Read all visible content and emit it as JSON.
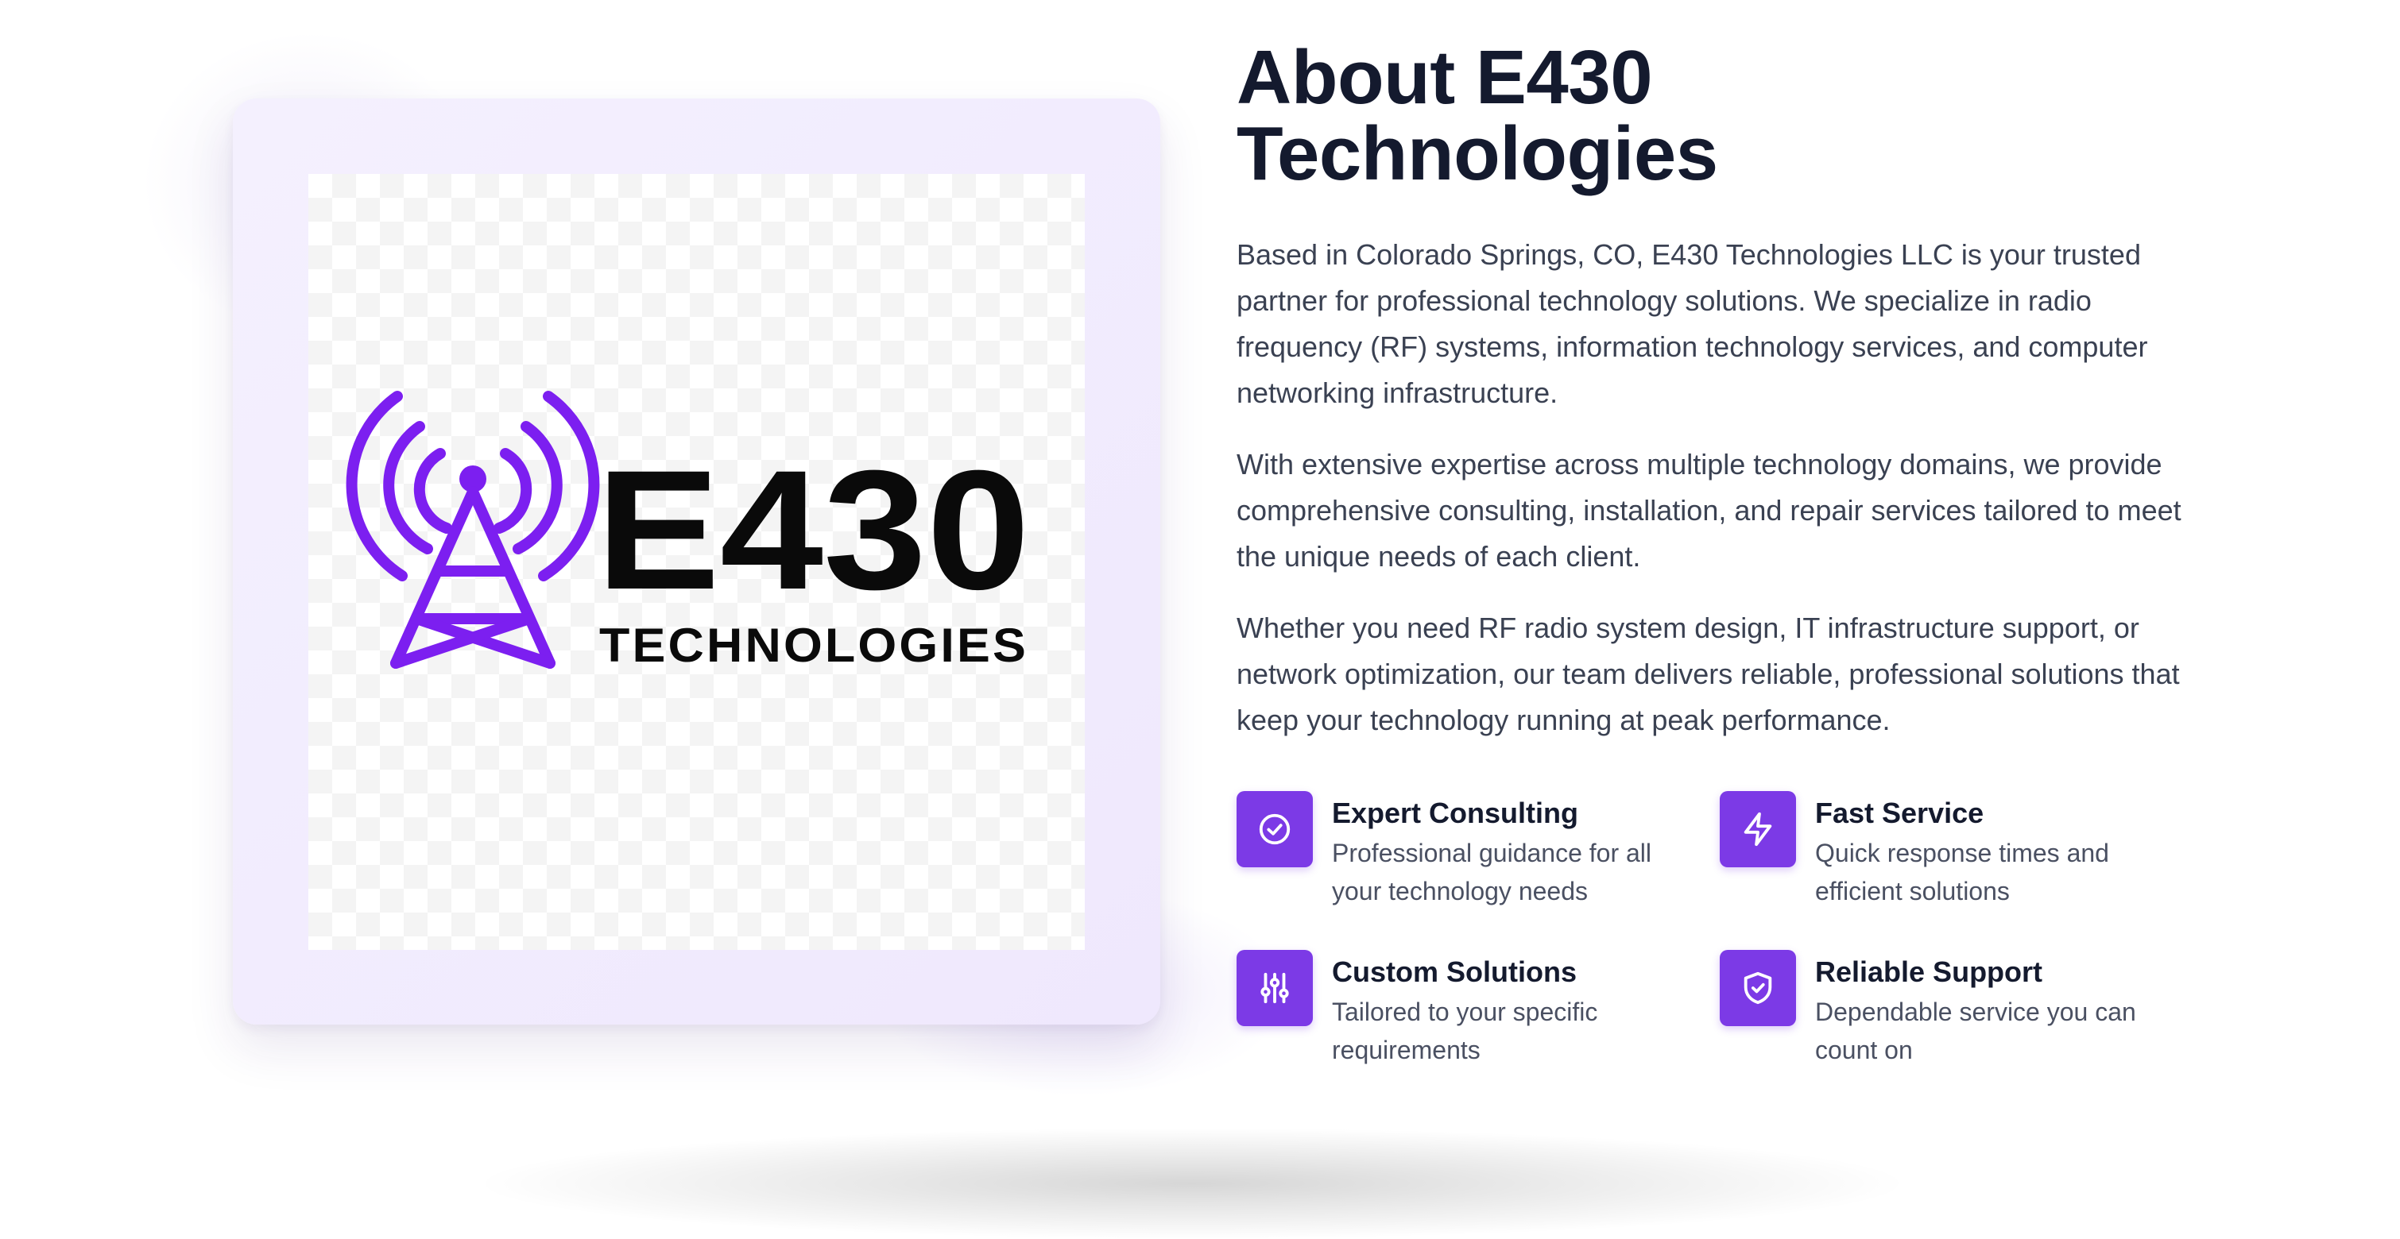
{
  "about": {
    "title_line1": "About E430",
    "title_line2": "Technologies",
    "paragraphs": [
      "Based in Colorado Springs, CO, E430 Technologies LLC is your trusted partner for professional technology solutions. We specialize in radio frequency (RF) systems, information technology services, and computer networking infrastructure.",
      "With extensive expertise across multiple technology domains, we provide comprehensive consulting, installation, and repair services tailored to meet the unique needs of each client.",
      "Whether you need RF radio system design, IT infrastructure support, or network optimization, our team delivers reliable, professional solutions that keep your technology running at peak performance."
    ]
  },
  "logo": {
    "mark": "E430",
    "sub": "TECHNOLOGIES",
    "icon": "radio-tower-icon",
    "accent_color": "#7c1ff0"
  },
  "features": [
    {
      "icon": "check-circle-icon",
      "title": "Expert Consulting",
      "desc": "Professional guidance for all your technology needs"
    },
    {
      "icon": "lightning-icon",
      "title": "Fast Service",
      "desc": "Quick response times and efficient solutions"
    },
    {
      "icon": "sliders-icon",
      "title": "Custom Solutions",
      "desc": "Tailored to your specific requirements"
    },
    {
      "icon": "shield-check-icon",
      "title": "Reliable Support",
      "desc": "Dependable service you can count on"
    }
  ],
  "colors": {
    "accent": "#7c3ae6",
    "heading": "#141a2e",
    "body_text": "#3a4152",
    "card_background": "#f2ecfd"
  }
}
